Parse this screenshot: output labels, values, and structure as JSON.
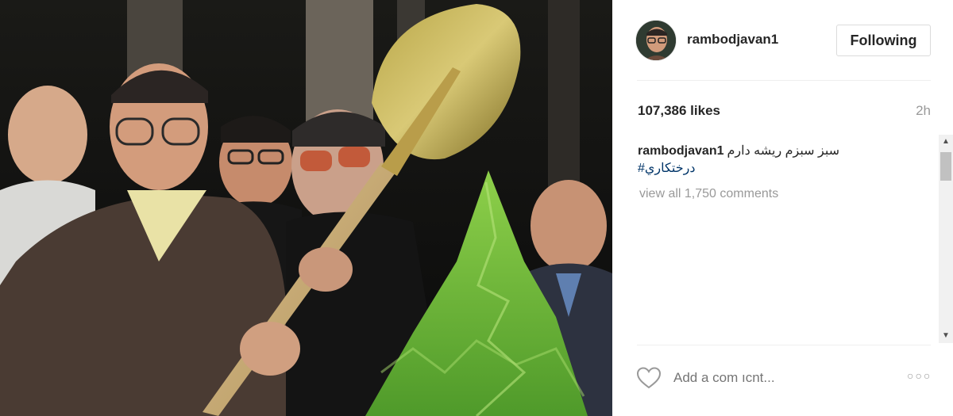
{
  "post": {
    "username": "rambodjavan1",
    "follow_button": "Following",
    "likes": "107,386 likes",
    "time": "2h",
    "caption": {
      "text": "سبز سبزم ریشه دارم",
      "hashtag": "#درختکاري"
    },
    "view_all_comments": "view all 1,750 comments",
    "add_comment_placeholder": "Add a com ıcnt..."
  },
  "icons": {
    "like": "heart-icon",
    "more": "more-options-icon",
    "scroll_up": "scroll-up-arrow-icon",
    "scroll_down": "scroll-down-arrow-icon"
  },
  "colors": {
    "text": "#262626",
    "secondary": "#999999",
    "hashtag": "#003569",
    "border": "#dbdbdb"
  }
}
